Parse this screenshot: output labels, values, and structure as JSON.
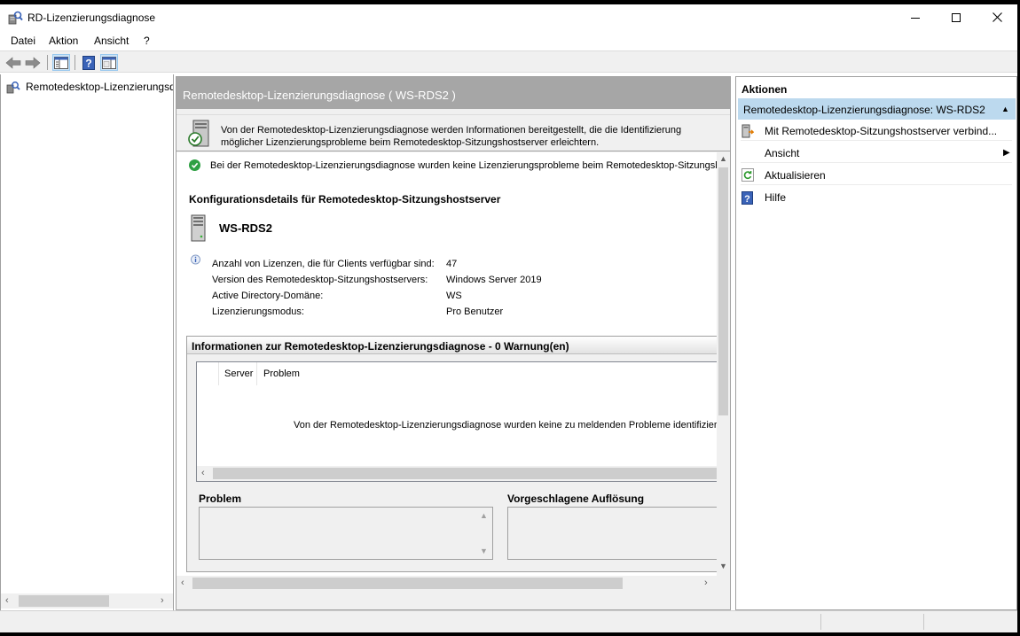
{
  "window": {
    "title": "RD-Lizenzierungsdiagnose"
  },
  "menu": {
    "items": [
      "Datei",
      "Aktion",
      "Ansicht",
      "?"
    ]
  },
  "tree": {
    "root_label": "Remotedesktop-Lizenzierungsdiagnose"
  },
  "center": {
    "header": "Remotedesktop-Lizenzierungsdiagnose ( WS-RDS2 )",
    "intro": "Von der Remotedesktop-Lizenzierungsdiagnose werden Informationen bereitgestellt, die die Identifizierung möglicher Lizenzierungsprobleme beim Remotedesktop-Sitzungshostserver erleichtern.",
    "status_message": "Bei der Remotedesktop-Lizenzierungsdiagnose wurden keine Lizenzierungsprobleme beim Remotedesktop-Sitzungshostserver identifiziert.",
    "config_title": "Konfigurationsdetails für Remotedesktop-Sitzungshostserver",
    "server_name": "WS-RDS2",
    "details": [
      {
        "label": "Anzahl von Lizenzen, die für Clients verfügbar sind:",
        "value": "47"
      },
      {
        "label": "Version des Remotedesktop-Sitzungshostservers:",
        "value": "Windows Server 2019"
      },
      {
        "label": "Active Directory-Domäne:",
        "value": "WS"
      },
      {
        "label": "Lizenzierungsmodus:",
        "value": "Pro Benutzer"
      }
    ],
    "diagnosis": {
      "title": "Informationen zur Remotedesktop-Lizenzierungsdiagnose - 0 Warnung(en)",
      "columns": [
        "Server",
        "Problem"
      ],
      "empty_message": "Von der Remotedesktop-Lizenzierungsdiagnose wurden keine zu meldenden Probleme identifiziert.",
      "problem_label": "Problem",
      "resolution_label": "Vorgeschlagene Auflösung"
    }
  },
  "actions": {
    "title": "Aktionen",
    "group_label": "Remotedesktop-Lizenzierungsdiagnose: WS-RDS2",
    "items": [
      {
        "label": "Mit Remotedesktop-Sitzungshostserver verbind...",
        "icon": "connect-server-icon"
      },
      {
        "label": "Ansicht",
        "icon": "none",
        "has_submenu": true
      },
      {
        "label": "Aktualisieren",
        "icon": "refresh-icon"
      },
      {
        "label": "Hilfe",
        "icon": "help-icon"
      }
    ]
  },
  "colors": {
    "header_gray": "#a6a6a6",
    "selection_blue": "#bcd9ee",
    "ok_green": "#2ea043",
    "help_blue": "#3a63b8"
  }
}
